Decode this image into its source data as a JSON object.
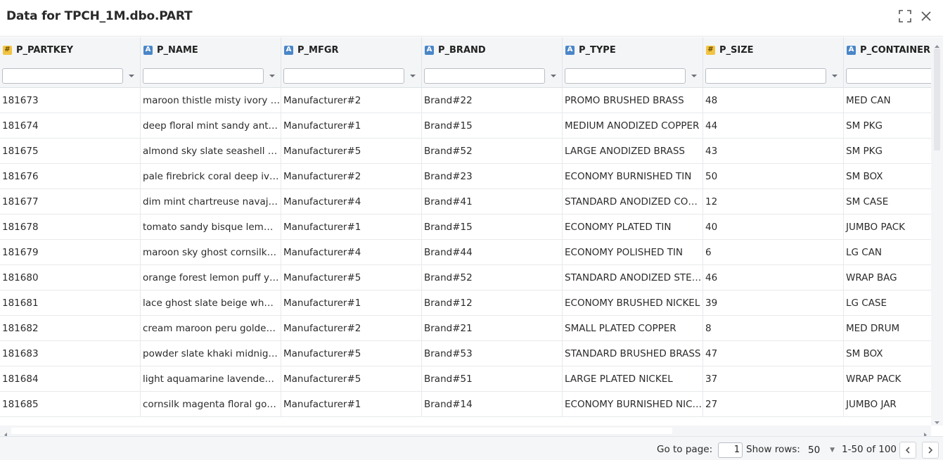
{
  "dialog": {
    "title": "Data for TPCH_1M.dbo.PART",
    "maximize_icon": "maximize-icon",
    "close_icon": "close-icon"
  },
  "columns": [
    {
      "name": "P_PARTKEY",
      "type": "#"
    },
    {
      "name": "P_NAME",
      "type": "A"
    },
    {
      "name": "P_MFGR",
      "type": "A"
    },
    {
      "name": "P_BRAND",
      "type": "A"
    },
    {
      "name": "P_TYPE",
      "type": "A"
    },
    {
      "name": "P_SIZE",
      "type": "#"
    },
    {
      "name": "P_CONTAINER",
      "type": "A"
    }
  ],
  "rows": [
    [
      "181673",
      "maroon thistle misty ivory …",
      "Manufacturer#2",
      "Brand#22",
      "PROMO BRUSHED BRASS",
      "48",
      "MED CAN"
    ],
    [
      "181674",
      "deep floral mint sandy ant…",
      "Manufacturer#1",
      "Brand#15",
      "MEDIUM ANODIZED COPPER",
      "44",
      "SM PKG"
    ],
    [
      "181675",
      "almond sky slate seashell …",
      "Manufacturer#5",
      "Brand#52",
      "LARGE ANODIZED BRASS",
      "43",
      "SM PKG"
    ],
    [
      "181676",
      "pale firebrick coral deep iv…",
      "Manufacturer#2",
      "Brand#23",
      "ECONOMY BURNISHED TIN",
      "50",
      "SM BOX"
    ],
    [
      "181677",
      "dim mint chartreuse navaj…",
      "Manufacturer#4",
      "Brand#41",
      "STANDARD ANODIZED COP…",
      "12",
      "SM CASE"
    ],
    [
      "181678",
      "tomato sandy bisque lem…",
      "Manufacturer#1",
      "Brand#15",
      "ECONOMY PLATED TIN",
      "40",
      "JUMBO PACK"
    ],
    [
      "181679",
      "maroon sky ghost cornsilk…",
      "Manufacturer#4",
      "Brand#44",
      "ECONOMY POLISHED TIN",
      "6",
      "LG CAN"
    ],
    [
      "181680",
      "orange forest lemon puff y…",
      "Manufacturer#5",
      "Brand#52",
      "STANDARD ANODIZED STEEL",
      "46",
      "WRAP BAG"
    ],
    [
      "181681",
      "lace ghost slate beige wh…",
      "Manufacturer#1",
      "Brand#12",
      "ECONOMY BRUSHED NICKEL",
      "39",
      "LG CASE"
    ],
    [
      "181682",
      "cream maroon peru golde…",
      "Manufacturer#2",
      "Brand#21",
      "SMALL PLATED COPPER",
      "8",
      "MED DRUM"
    ],
    [
      "181683",
      "powder slate khaki midnig…",
      "Manufacturer#5",
      "Brand#53",
      "STANDARD BRUSHED BRASS",
      "47",
      "SM BOX"
    ],
    [
      "181684",
      "light aquamarine lavende…",
      "Manufacturer#5",
      "Brand#51",
      "LARGE PLATED NICKEL",
      "37",
      "WRAP PACK"
    ],
    [
      "181685",
      "cornsilk magenta floral go…",
      "Manufacturer#1",
      "Brand#14",
      "ECONOMY BURNISHED NICK…",
      "27",
      "JUMBO JAR"
    ]
  ],
  "footer": {
    "goto_label": "Go to page:",
    "page_value": "1",
    "show_rows_label": "Show rows:",
    "rows_per_page": "50",
    "range_text": "1-50 of 100"
  },
  "colors": {
    "number_badge": "#f2c443",
    "text_badge": "#4a86c8",
    "header_bg": "#f3f5f7"
  }
}
